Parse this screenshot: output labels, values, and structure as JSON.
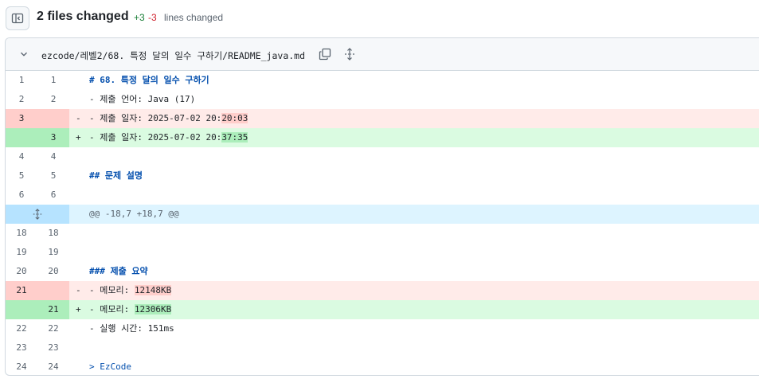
{
  "header": {
    "files_changed": "2 files changed",
    "additions": "+3",
    "deletions": "-3",
    "lines_changed_label": "lines changed"
  },
  "file": {
    "path": "ezcode/레벨2/68. 특정 달의 일수 구하기/README_java.md"
  },
  "lines": [
    {
      "type": "ctx",
      "old": "1",
      "new": "1",
      "marker": "",
      "text": "# 68. 특정 달의 일수 구하기",
      "style": "kw"
    },
    {
      "type": "ctx",
      "old": "2",
      "new": "2",
      "marker": "",
      "text": "- 제출 언어: Java (17)"
    },
    {
      "type": "del",
      "old": "3",
      "new": "",
      "marker": "-",
      "pre": "- 제출 일자: 2025-07-02 20:",
      "hl": "20:03"
    },
    {
      "type": "add",
      "old": "",
      "new": "3",
      "marker": "+",
      "pre": "- 제출 일자: 2025-07-02 20:",
      "hl": "37:35"
    },
    {
      "type": "ctx",
      "old": "4",
      "new": "4",
      "marker": "",
      "text": ""
    },
    {
      "type": "ctx",
      "old": "5",
      "new": "5",
      "marker": "",
      "text": "## 문제 설명",
      "style": "kw"
    },
    {
      "type": "ctx",
      "old": "6",
      "new": "6",
      "marker": "",
      "text": ""
    },
    {
      "type": "hunk",
      "text": "@@ -18,7 +18,7 @@"
    },
    {
      "type": "ctx",
      "old": "18",
      "new": "18",
      "marker": "",
      "text": ""
    },
    {
      "type": "ctx",
      "old": "19",
      "new": "19",
      "marker": "",
      "text": ""
    },
    {
      "type": "ctx",
      "old": "20",
      "new": "20",
      "marker": "",
      "text": "### 제출 요약",
      "style": "kw"
    },
    {
      "type": "del",
      "old": "21",
      "new": "",
      "marker": "-",
      "pre": "- 메모리: ",
      "hl": "12148KB"
    },
    {
      "type": "add",
      "old": "",
      "new": "21",
      "marker": "+",
      "pre": "- 메모리: ",
      "hl": "12306KB"
    },
    {
      "type": "ctx",
      "old": "22",
      "new": "22",
      "marker": "",
      "text": "- 실행 시간: 151ms"
    },
    {
      "type": "ctx",
      "old": "23",
      "new": "23",
      "marker": "",
      "text": ""
    },
    {
      "type": "ctx",
      "old": "24",
      "new": "24",
      "marker": "",
      "text": "> EzCode",
      "style": "link"
    }
  ],
  "colors": {
    "addition": "#1a7f37",
    "deletion": "#cf222e",
    "accent": "#0550ae"
  },
  "icons": {
    "sidebar_toggle": "sidebar-panel-icon",
    "collapse": "chevron-down-icon",
    "copy": "copy-icon",
    "expand": "unfold-icon"
  }
}
